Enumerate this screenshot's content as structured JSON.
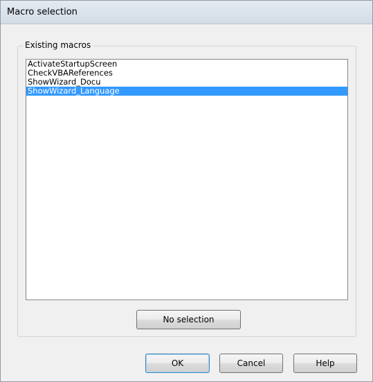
{
  "window": {
    "title": "Macro selection"
  },
  "group": {
    "label": "Existing macros"
  },
  "macros": {
    "items": [
      {
        "label": "ActivateStartupScreen",
        "selected": false
      },
      {
        "label": "CheckVBAReferences",
        "selected": false
      },
      {
        "label": "ShowWizard_Docu",
        "selected": false
      },
      {
        "label": "ShowWizard_Language",
        "selected": true
      }
    ]
  },
  "buttons": {
    "no_selection": "No selection",
    "ok": "OK",
    "cancel": "Cancel",
    "help": "Help"
  },
  "colors": {
    "selection": "#3399ff",
    "dialog_bg": "#f0f0f0",
    "titlebar": "#dde4ec"
  }
}
